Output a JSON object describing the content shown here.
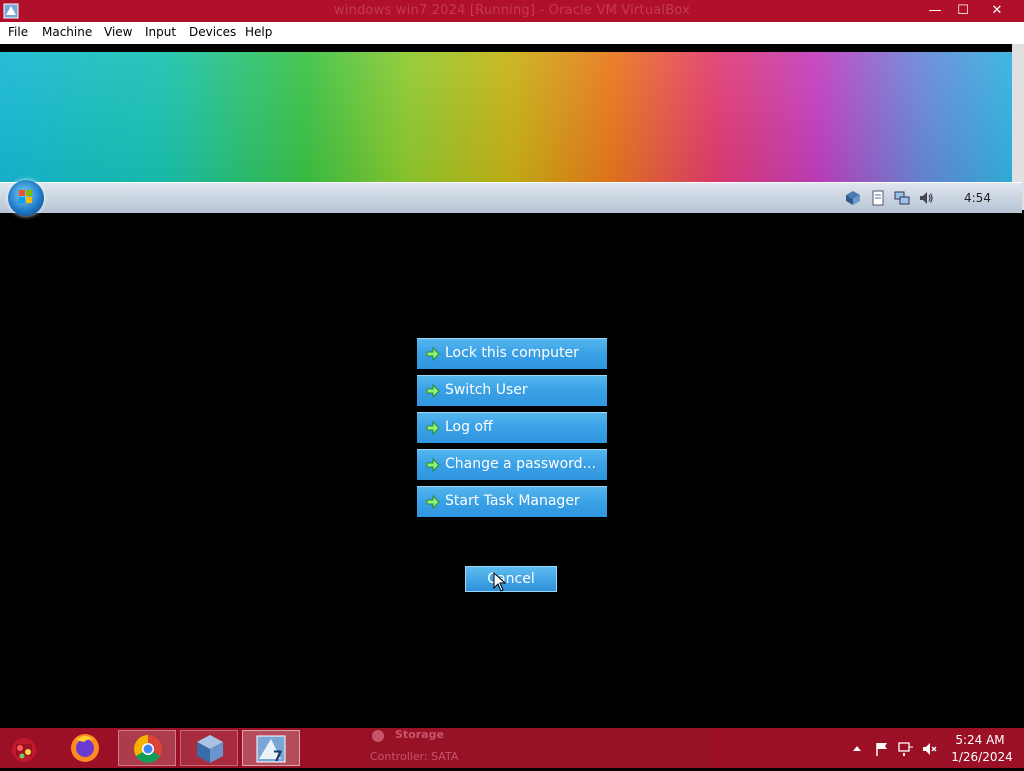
{
  "window": {
    "title": "windows win7 2024 [Running] - Oracle VM VirtualBox",
    "minimize": "—",
    "maximize": "☐",
    "close": "✕"
  },
  "menu": {
    "items": [
      "File",
      "Machine",
      "View",
      "Input",
      "Devices",
      "Help"
    ]
  },
  "guest": {
    "clock": "4:54",
    "tray_icons": [
      "virtualbox-tray-icon",
      "document-icon",
      "network-icon",
      "speaker-icon"
    ]
  },
  "security_options": {
    "items": [
      "Lock this computer",
      "Switch User",
      "Log off",
      "Change a password...",
      "Start Task Manager"
    ],
    "cancel": "Cancel"
  },
  "host_taskbar": {
    "apps": [
      "start-button",
      "firefox",
      "chrome",
      "virtualbox",
      "win7-vm"
    ],
    "preview_title": "Storage",
    "preview_subtitle": "Controller: SATA",
    "time": "5:24 AM",
    "date": "1/26/2024"
  },
  "colors": {
    "host_titlebar": "#b0102a",
    "host_taskbar": "#9b1024",
    "option_button": "#3aa1e6"
  }
}
